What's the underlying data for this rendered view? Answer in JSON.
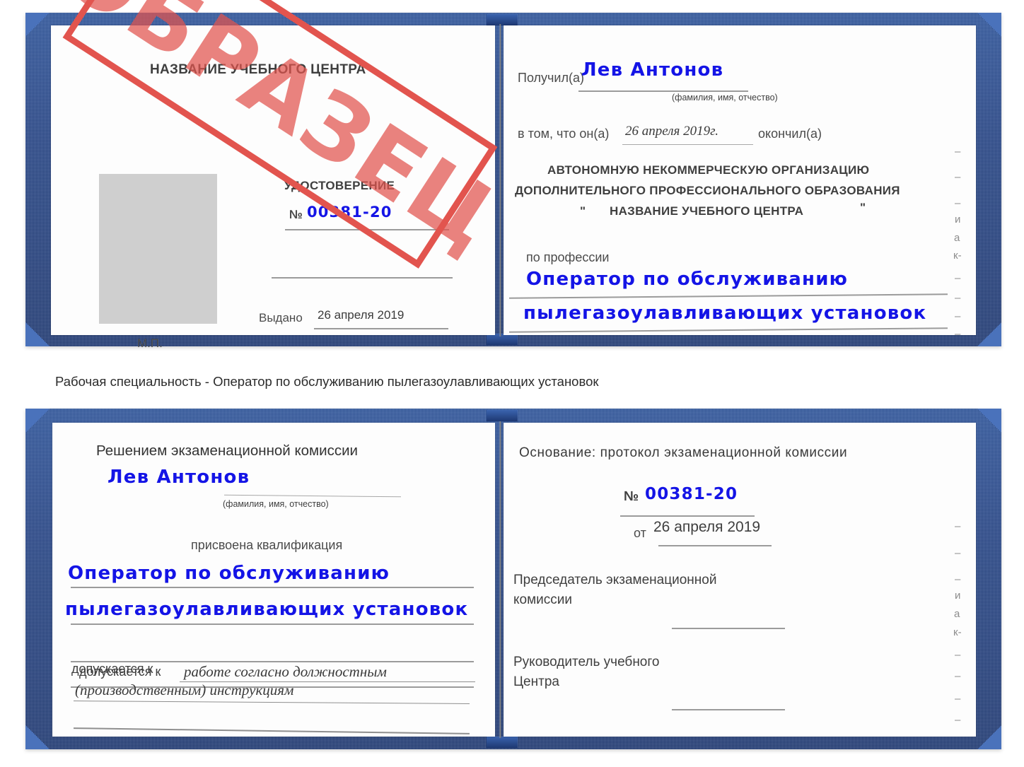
{
  "caption": "Рабочая специальность - Оператор по обслуживанию пылегазоулавливающих установок",
  "watermark": {
    "text": "ОБРАЗЕЦ",
    "color": "#e2544e"
  },
  "colors": {
    "cover_blue": "#27478b",
    "handwriting_blue": "#1414e6",
    "stamp_red": "#e2544e",
    "rule_gray": "#9b9b9b",
    "photo_placeholder": "#cfcfcf"
  },
  "certificate_top": {
    "left_page": {
      "org_title": "НАЗВАНИЕ УЧЕБНОГО ЦЕНТРА",
      "doc_title": "УДОСТОВЕРЕНИЕ",
      "number_label": "№",
      "number_value": "00381-20",
      "issued_label": "Выдано",
      "issued_value": "26 апреля 2019",
      "seal_label": "М.П.",
      "photo_placeholder": "photo-placeholder"
    },
    "right_page": {
      "received_label": "Получил(а)",
      "received_value": "Лев Антонов",
      "fio_hint": "(фамилия, имя, отчество)",
      "that_he_label": "в том, что он(а)",
      "that_he_value": "26 апреля 2019г.",
      "finished_label": "окончил(а)",
      "org_line1": "АВТОНОМНУЮ НЕКОММЕРЧЕСКУЮ ОРГАНИЗАЦИЮ",
      "org_line2": "ДОПОЛНИТЕЛЬНОГО ПРОФЕССИОНАЛЬНОГО ОБРАЗОВАНИЯ",
      "org_quote_open": "\"",
      "org_line3": "НАЗВАНИЕ УЧЕБНОГО ЦЕНТРА",
      "org_quote_close": "\"",
      "profession_label": "по профессии",
      "profession_line1": "Оператор по обслуживанию",
      "profession_line2": "пылегазоулавливающих установок",
      "edge_fragments": [
        "–",
        "–",
        "–",
        "и",
        "а",
        "к-",
        "–",
        "–",
        "–",
        "–"
      ]
    }
  },
  "certificate_bottom": {
    "left_page": {
      "decision_title": "Решением экзаменационной комиссии",
      "name_value": "Лев Антонов",
      "fio_hint": "(фамилия, имя, отчество)",
      "qualification_label": "присвоена квалификация",
      "qualification_line1": "Оператор по обслуживанию",
      "qualification_line2": "пылегазоулавливающих установок",
      "allowed_label": "допускается к",
      "allowed_value_line1": "работе согласно должностным",
      "allowed_value_line2": "(производственным) инструкциям"
    },
    "right_page": {
      "basis_label": "Основание: протокол экзаменационной комиссии",
      "number_label": "№",
      "number_value": "00381-20",
      "date_label": "от",
      "date_value": "26 апреля 2019",
      "chairman_line1": "Председатель экзаменационной",
      "chairman_line2": "комиссии",
      "head_line1": "Руководитель учебного",
      "head_line2": "Центра",
      "edge_fragments": [
        "–",
        "–",
        "–",
        "и",
        "а",
        "к-",
        "–",
        "–",
        "–",
        "–"
      ]
    }
  }
}
